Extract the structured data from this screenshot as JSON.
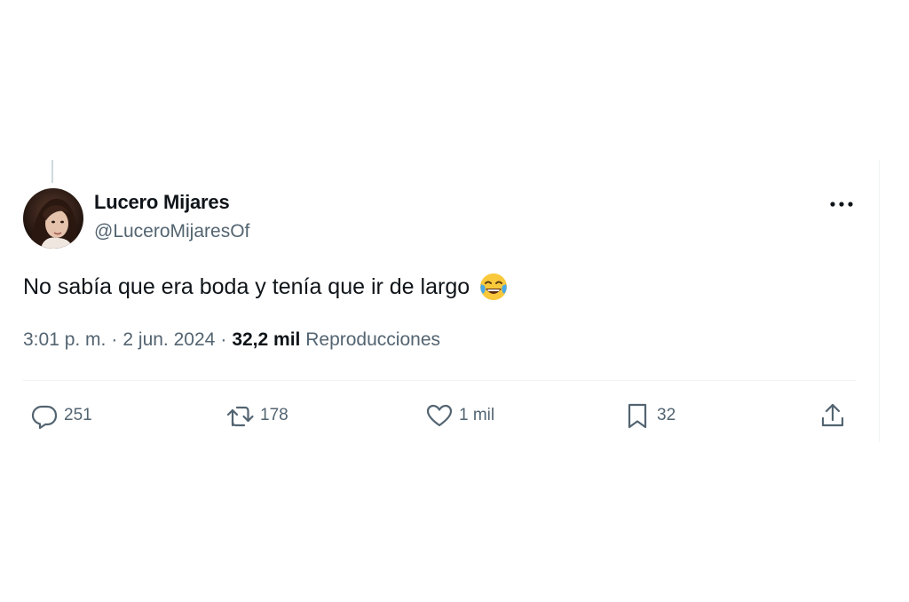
{
  "author": {
    "name": "Lucero Mijares",
    "handle": "@LuceroMijaresOf"
  },
  "tweet": {
    "text": "No sabía que era boda y tenía que ir de largo",
    "emoji": "face-with-tears-of-joy-icon"
  },
  "meta": {
    "time": "3:01 p. m.",
    "date": "2 jun. 2024",
    "views_count": "32,2 mil",
    "views_label": "Reproducciones",
    "separator": "·"
  },
  "actions": {
    "replies": "251",
    "retweets": "178",
    "likes": "1 mil",
    "bookmarks": "32"
  },
  "icons": {
    "more": "more-horizontal-icon",
    "reply": "reply-icon",
    "retweet": "retweet-icon",
    "like": "heart-icon",
    "bookmark": "bookmark-icon",
    "share": "share-icon"
  },
  "colors": {
    "text": "#0f1419",
    "secondary": "#536471",
    "divider": "#eff3f4"
  }
}
